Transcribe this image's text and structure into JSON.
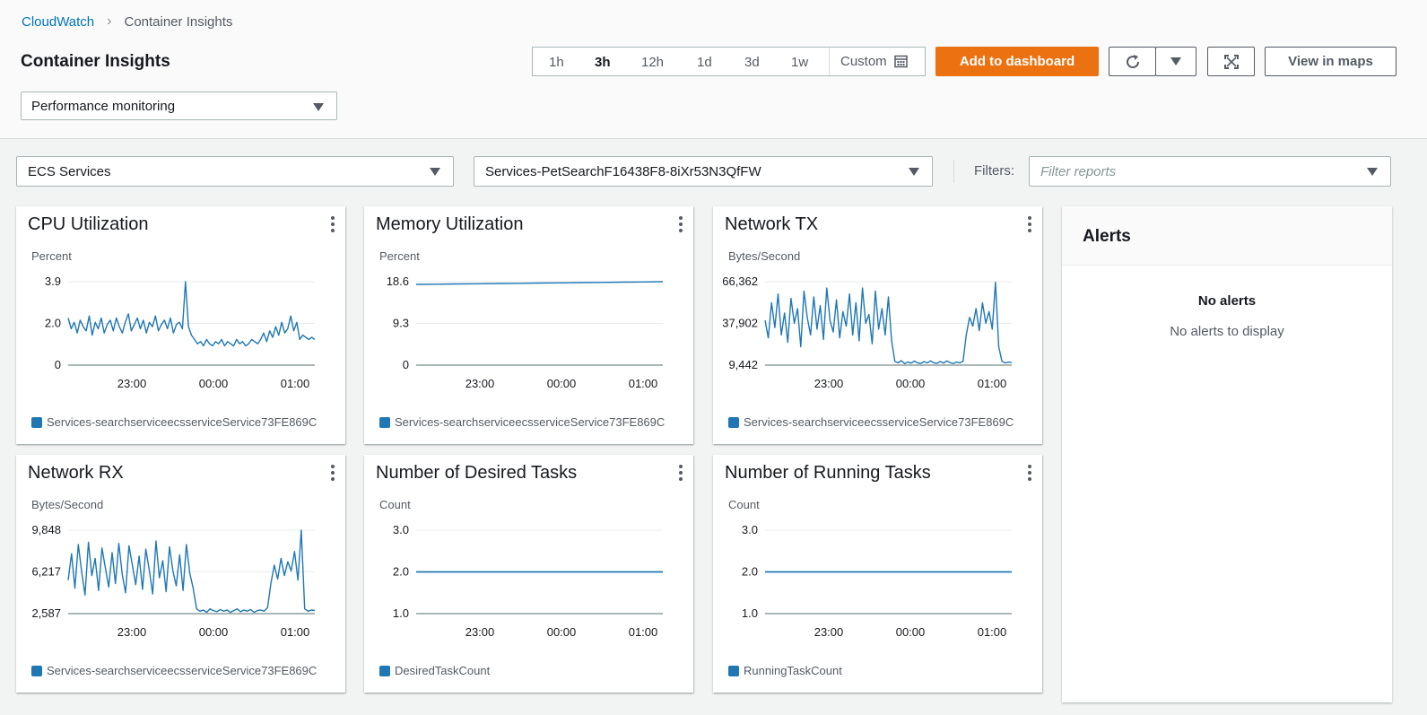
{
  "breadcrumb": {
    "root": "CloudWatch",
    "current": "Container Insights"
  },
  "page_title": "Container Insights",
  "mode_select": "Performance monitoring",
  "time_range": {
    "options": [
      "1h",
      "3h",
      "12h",
      "1d",
      "3d",
      "1w"
    ],
    "active": "3h",
    "custom_label": "Custom"
  },
  "toolbar": {
    "add_to_dashboard": "Add to dashboard",
    "view_in_maps": "View in maps"
  },
  "filters": {
    "resource_type": "ECS Services",
    "resource_name": "Services-PetSearchF16438F8-8iXr53N3QfFW",
    "label": "Filters:",
    "placeholder": "Filter reports"
  },
  "alerts": {
    "title": "Alerts",
    "empty_title": "No alerts",
    "empty_body": "No alerts to display"
  },
  "colors": {
    "series": "#1f77b4",
    "accent": "#ec7211",
    "link": "#0073bb"
  },
  "charts": [
    {
      "title": "CPU Utilization",
      "unit": "Percent",
      "yticks": [
        "3.9",
        "2.0",
        "0"
      ],
      "xticks": [
        "23:00",
        "00:00",
        "01:00"
      ],
      "legend": "Services-searchserviceecsserviceService73FE869C"
    },
    {
      "title": "Memory Utilization",
      "unit": "Percent",
      "yticks": [
        "18.6",
        "9.3",
        "0"
      ],
      "xticks": [
        "23:00",
        "00:00",
        "01:00"
      ],
      "legend": "Services-searchserviceecsserviceService73FE869C"
    },
    {
      "title": "Network TX",
      "unit": "Bytes/Second",
      "yticks": [
        "66,362",
        "37,902",
        "9,442"
      ],
      "xticks": [
        "23:00",
        "00:00",
        "01:00"
      ],
      "legend": "Services-searchserviceecsserviceService73FE869C"
    },
    {
      "title": "Network RX",
      "unit": "Bytes/Second",
      "yticks": [
        "9,848",
        "6,217",
        "2,587"
      ],
      "xticks": [
        "23:00",
        "00:00",
        "01:00"
      ],
      "legend": "Services-searchserviceecsserviceService73FE869C"
    },
    {
      "title": "Number of Desired Tasks",
      "unit": "Count",
      "yticks": [
        "3.0",
        "2.0",
        "1.0"
      ],
      "xticks": [
        "23:00",
        "00:00",
        "01:00"
      ],
      "legend": "DesiredTaskCount"
    },
    {
      "title": "Number of Running Tasks",
      "unit": "Count",
      "yticks": [
        "3.0",
        "2.0",
        "1.0"
      ],
      "xticks": [
        "23:00",
        "00:00",
        "01:00"
      ],
      "legend": "RunningTaskCount"
    }
  ],
  "chart_data": [
    {
      "type": "line",
      "title": "CPU Utilization",
      "ylabel": "Percent",
      "ylim": [
        0,
        3.9
      ],
      "xticks": [
        "23:00",
        "00:00",
        "01:00"
      ],
      "series": [
        {
          "name": "Services-searchserviceecsserviceService73FE869C",
          "values": [
            2.2,
            1.7,
            2.0,
            1.5,
            2.1,
            1.8,
            1.6,
            2.3,
            1.4,
            2.0,
            1.7,
            2.2,
            1.5,
            1.9,
            2.1,
            1.6,
            2.2,
            1.8,
            1.5,
            2.0,
            2.4,
            1.6,
            1.9,
            2.2,
            1.7,
            2.1,
            1.5,
            2.0,
            1.8,
            2.3,
            1.6,
            1.9,
            2.1,
            1.7,
            2.2,
            1.5,
            1.9,
            2.0,
            1.7,
            3.9,
            1.8,
            1.4,
            1.2,
            1.0,
            1.1,
            0.9,
            1.2,
            1.0,
            0.9,
            1.1,
            1.0,
            1.2,
            0.9,
            1.1,
            1.0,
            0.9,
            1.2,
            1.0,
            1.1,
            0.9,
            1.0,
            1.2,
            1.1,
            1.0,
            1.2,
            1.5,
            1.1,
            1.6,
            1.3,
            1.8,
            1.4,
            2.0,
            1.5,
            1.7,
            2.3,
            1.6,
            2.0,
            1.2,
            1.4,
            1.3,
            1.2,
            1.3,
            1.2
          ]
        }
      ]
    },
    {
      "type": "line",
      "title": "Memory Utilization",
      "ylabel": "Percent",
      "ylim": [
        0,
        18.6
      ],
      "xticks": [
        "23:00",
        "00:00",
        "01:00"
      ],
      "series": [
        {
          "name": "Services-searchserviceecsserviceService73FE869C",
          "values": [
            18.0,
            18.05,
            18.1,
            18.15,
            18.2,
            18.25,
            18.3,
            18.35,
            18.4,
            18.45,
            18.5,
            18.55,
            18.6
          ]
        }
      ]
    },
    {
      "type": "line",
      "title": "Network TX",
      "ylabel": "Bytes/Second",
      "ylim": [
        9442,
        66362
      ],
      "xticks": [
        "23:00",
        "00:00",
        "01:00"
      ],
      "series": [
        {
          "name": "Services-searchserviceecsserviceService73FE869C",
          "values": [
            40000,
            28000,
            52000,
            35000,
            58000,
            30000,
            45000,
            25000,
            55000,
            38000,
            48000,
            22000,
            60000,
            42000,
            30000,
            56000,
            34000,
            50000,
            27000,
            62000,
            40000,
            32000,
            54000,
            28000,
            46000,
            36000,
            58000,
            30000,
            52000,
            26000,
            62000,
            38000,
            44000,
            24000,
            60000,
            34000,
            48000,
            30000,
            56000,
            26000,
            12000,
            11000,
            12500,
            10500,
            11500,
            10800,
            12200,
            11000,
            10600,
            11800,
            10900,
            12400,
            11000,
            10700,
            11900,
            10800,
            12300,
            11100,
            10600,
            11500,
            11000,
            12000,
            30000,
            42000,
            36000,
            48000,
            33000,
            52000,
            38000,
            46000,
            34000,
            66000,
            22000,
            12000,
            11000,
            11500,
            11200
          ]
        }
      ]
    },
    {
      "type": "line",
      "title": "Network RX",
      "ylabel": "Bytes/Second",
      "ylim": [
        2587,
        9848
      ],
      "xticks": [
        "23:00",
        "00:00",
        "01:00"
      ],
      "series": [
        {
          "name": "Services-searchserviceecsserviceService73FE869C",
          "values": [
            5500,
            7800,
            4800,
            8600,
            6200,
            4200,
            8800,
            5900,
            7400,
            4600,
            8300,
            6600,
            4900,
            7900,
            5200,
            8700,
            6000,
            4400,
            8500,
            6800,
            5100,
            7600,
            4700,
            8200,
            6400,
            4300,
            8900,
            5700,
            7200,
            4500,
            8400,
            6300,
            5000,
            7700,
            4600,
            8600,
            6100,
            4800,
            3000,
            2800,
            2900,
            2700,
            3000,
            2850,
            2750,
            2950,
            2800,
            2900,
            2700,
            2850,
            3000,
            2750,
            2900,
            2800,
            2950,
            2700,
            2850,
            2900,
            2800,
            3100,
            5200,
            6800,
            5600,
            7400,
            5900,
            7100,
            6300,
            8000,
            5500,
            9848,
            3000,
            2800,
            2900,
            2850
          ]
        }
      ]
    },
    {
      "type": "line",
      "title": "Number of Desired Tasks",
      "ylabel": "Count",
      "ylim": [
        1.0,
        3.0
      ],
      "xticks": [
        "23:00",
        "00:00",
        "01:00"
      ],
      "series": [
        {
          "name": "DesiredTaskCount",
          "values": [
            2.0,
            2.0
          ]
        }
      ]
    },
    {
      "type": "line",
      "title": "Number of Running Tasks",
      "ylabel": "Count",
      "ylim": [
        1.0,
        3.0
      ],
      "xticks": [
        "23:00",
        "00:00",
        "01:00"
      ],
      "series": [
        {
          "name": "RunningTaskCount",
          "values": [
            2.0,
            2.0
          ]
        }
      ]
    }
  ]
}
